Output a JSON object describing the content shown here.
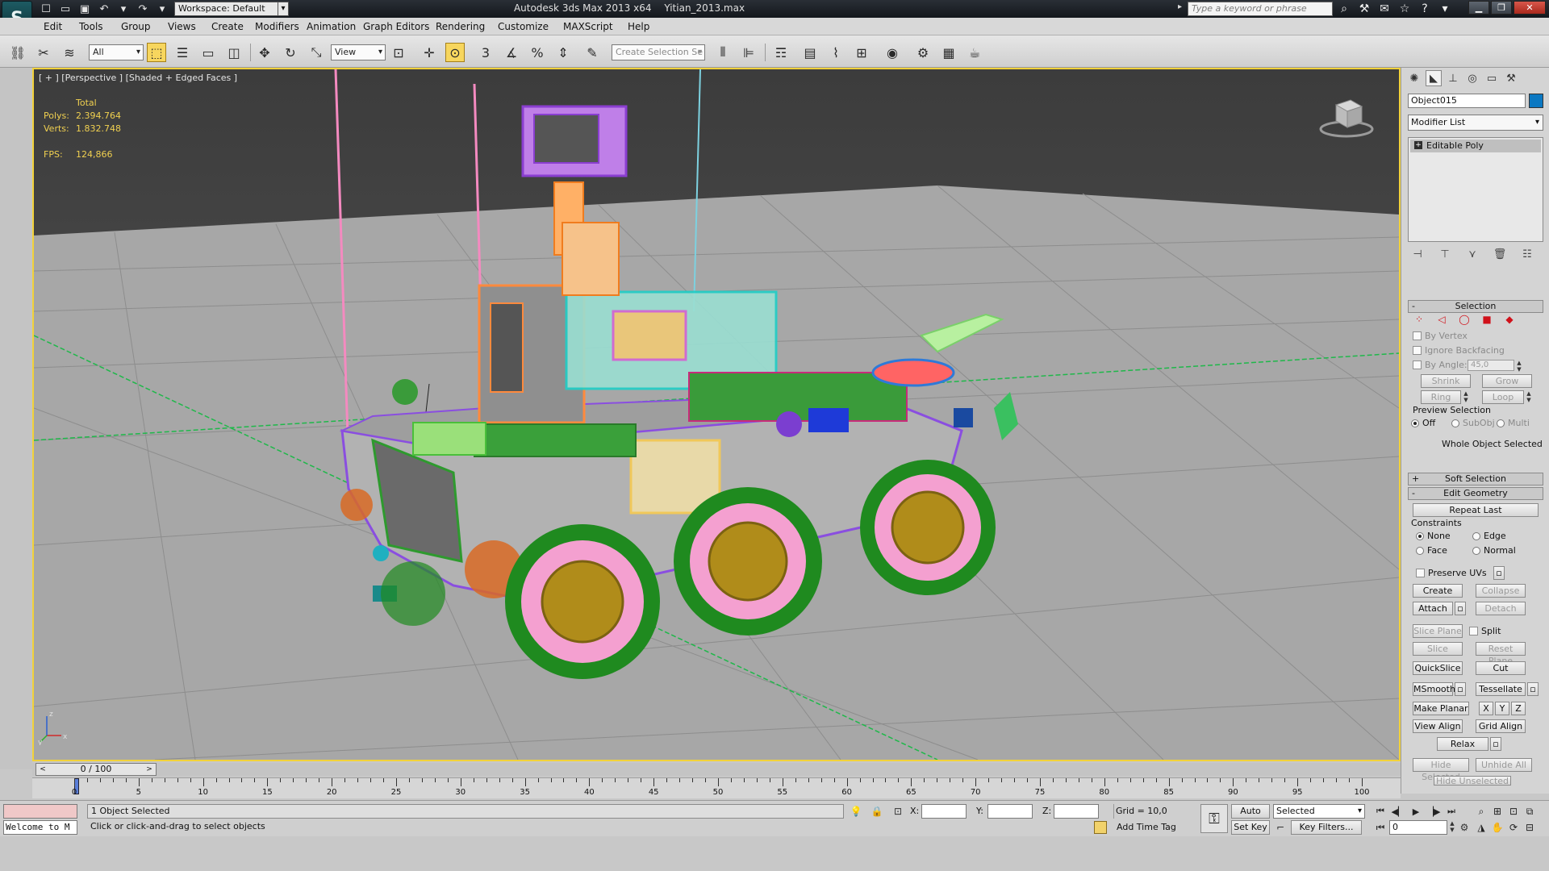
{
  "titlebar": {
    "workspace": "Workspace: Default",
    "app_title": "Autodesk 3ds Max  2013 x64",
    "file_name": "Yitian_2013.max",
    "search_placeholder": "Type a keyword or phrase"
  },
  "menu": [
    "Edit",
    "Tools",
    "Group",
    "Views",
    "Create",
    "Modifiers",
    "Animation",
    "Graph Editors",
    "Rendering",
    "Customize",
    "MAXScript",
    "Help"
  ],
  "toolbar": {
    "filter_value": "All",
    "coord_system": "View",
    "selection_set_placeholder": "Create Selection Se",
    "snap_labels": [
      "3",
      "%"
    ]
  },
  "viewport": {
    "label": "[ + ] [Perspective ] [Shaded + Edged Faces ]",
    "stats": {
      "total_label": "Total",
      "polys_label": "Polys:",
      "polys_value": "2.394.764",
      "verts_label": "Verts:",
      "verts_value": "1.832.748",
      "fps_label": "FPS:",
      "fps_value": "124,866"
    },
    "axis_labels": [
      "x",
      "y",
      "z"
    ]
  },
  "command_panel": {
    "object_name": "Object015",
    "object_color": "#0b78c2",
    "modifier_list": "Modifier List",
    "stack_item": "Editable Poly",
    "selection": {
      "title": "Selection",
      "by_vertex": "By Vertex",
      "ignore_backfacing": "Ignore Backfacing",
      "by_angle": "By Angle:",
      "angle_value": "45,0",
      "shrink": "Shrink",
      "grow": "Grow",
      "ring": "Ring",
      "loop": "Loop",
      "preview_selection": "Preview Selection",
      "preview_off": "Off",
      "preview_subobj": "SubObj",
      "preview_multi": "Multi",
      "status": "Whole Object Selected"
    },
    "soft_selection": "Soft Selection",
    "edit_geometry": {
      "title": "Edit Geometry",
      "repeat_last": "Repeat Last",
      "constraints": "Constraints",
      "none": "None",
      "edge": "Edge",
      "face": "Face",
      "normal": "Normal",
      "preserve_uvs": "Preserve UVs",
      "create": "Create",
      "collapse": "Collapse",
      "attach": "Attach",
      "detach": "Detach",
      "slice_plane": "Slice Plane",
      "split": "Split",
      "slice": "Slice",
      "reset_plane": "Reset Plane",
      "quickslice": "QuickSlice",
      "cut": "Cut",
      "msmooth": "MSmooth",
      "tessellate": "Tessellate",
      "make_planar": "Make Planar",
      "x": "X",
      "y": "Y",
      "z": "Z",
      "view_align": "View Align",
      "grid_align": "Grid Align",
      "relax": "Relax",
      "hide_selected": "Hide Selected",
      "unhide_all": "Unhide All",
      "hide_unselected": "Hide Unselected"
    }
  },
  "timeline": {
    "slider": "0 / 100",
    "ticks": [
      "0",
      "5",
      "10",
      "15",
      "20",
      "25",
      "30",
      "35",
      "40",
      "45",
      "50",
      "55",
      "60",
      "65",
      "70",
      "75",
      "80",
      "85",
      "90",
      "95",
      "100"
    ]
  },
  "status": {
    "maxscript_text": "Welcome to M",
    "selection_text": "1 Object Selected",
    "prompt_text": "Click or click-and-drag to select objects",
    "x_label": "X:",
    "y_label": "Y:",
    "z_label": "Z:",
    "grid": "Grid = 10,0",
    "add_time_tag": "Add Time Tag",
    "auto_key": "Auto Key",
    "set_key": "Set Key",
    "selected_option": "Selected",
    "key_filters": "Key Filters...",
    "current_frame": "0"
  }
}
